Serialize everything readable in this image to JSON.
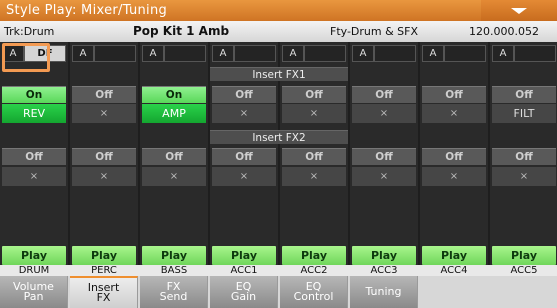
{
  "header": {
    "title": "Style Play: Mixer/Tuning",
    "menu_icon": "chevron-down-icon"
  },
  "info": {
    "track": "Trk:Drum",
    "kit": "Pop Kit 1 Amb",
    "category": "Fty-Drum & SFX",
    "bank_value": "120.000.052"
  },
  "sections": {
    "insert_fx1": "Insert FX1",
    "insert_fx2": "Insert FX2"
  },
  "channels": [
    {
      "a": "A",
      "b": "DF",
      "fx1_state": "On",
      "fx1_name": "REV",
      "fx2_state": "Off",
      "fx2_name": "×",
      "play": "Play",
      "label": "DRUM"
    },
    {
      "a": "A",
      "b": "",
      "fx1_state": "Off",
      "fx1_name": "×",
      "fx2_state": "Off",
      "fx2_name": "×",
      "play": "Play",
      "label": "PERC"
    },
    {
      "a": "A",
      "b": "",
      "fx1_state": "On",
      "fx1_name": "AMP",
      "fx2_state": "Off",
      "fx2_name": "×",
      "play": "Play",
      "label": "BASS"
    },
    {
      "a": "A",
      "b": "",
      "fx1_state": "Off",
      "fx1_name": "×",
      "fx2_state": "Off",
      "fx2_name": "×",
      "play": "Play",
      "label": "ACC1"
    },
    {
      "a": "A",
      "b": "",
      "fx1_state": "Off",
      "fx1_name": "×",
      "fx2_state": "Off",
      "fx2_name": "×",
      "play": "Play",
      "label": "ACC2"
    },
    {
      "a": "A",
      "b": "",
      "fx1_state": "Off",
      "fx1_name": "×",
      "fx2_state": "Off",
      "fx2_name": "×",
      "play": "Play",
      "label": "ACC3"
    },
    {
      "a": "A",
      "b": "",
      "fx1_state": "Off",
      "fx1_name": "×",
      "fx2_state": "Off",
      "fx2_name": "×",
      "play": "Play",
      "label": "ACC4"
    },
    {
      "a": "A",
      "b": "",
      "fx1_state": "Off",
      "fx1_name": "FILT",
      "fx2_state": "Off",
      "fx2_name": "×",
      "play": "Play",
      "label": "ACC5"
    }
  ],
  "tabs": [
    {
      "label": "Volume\nPan",
      "active": false
    },
    {
      "label": "Insert\nFX",
      "active": true
    },
    {
      "label": "FX\nSend",
      "active": false
    },
    {
      "label": "EQ\nGain",
      "active": false
    },
    {
      "label": "EQ\nControl",
      "active": false
    },
    {
      "label": "Tuning",
      "active": false
    }
  ],
  "colors": {
    "title_orange": "#e18b39",
    "on_green": "#6fe06f",
    "fx_green": "#1fbf3d",
    "play_green": "#8ae872",
    "highlight": "#f39a52"
  }
}
